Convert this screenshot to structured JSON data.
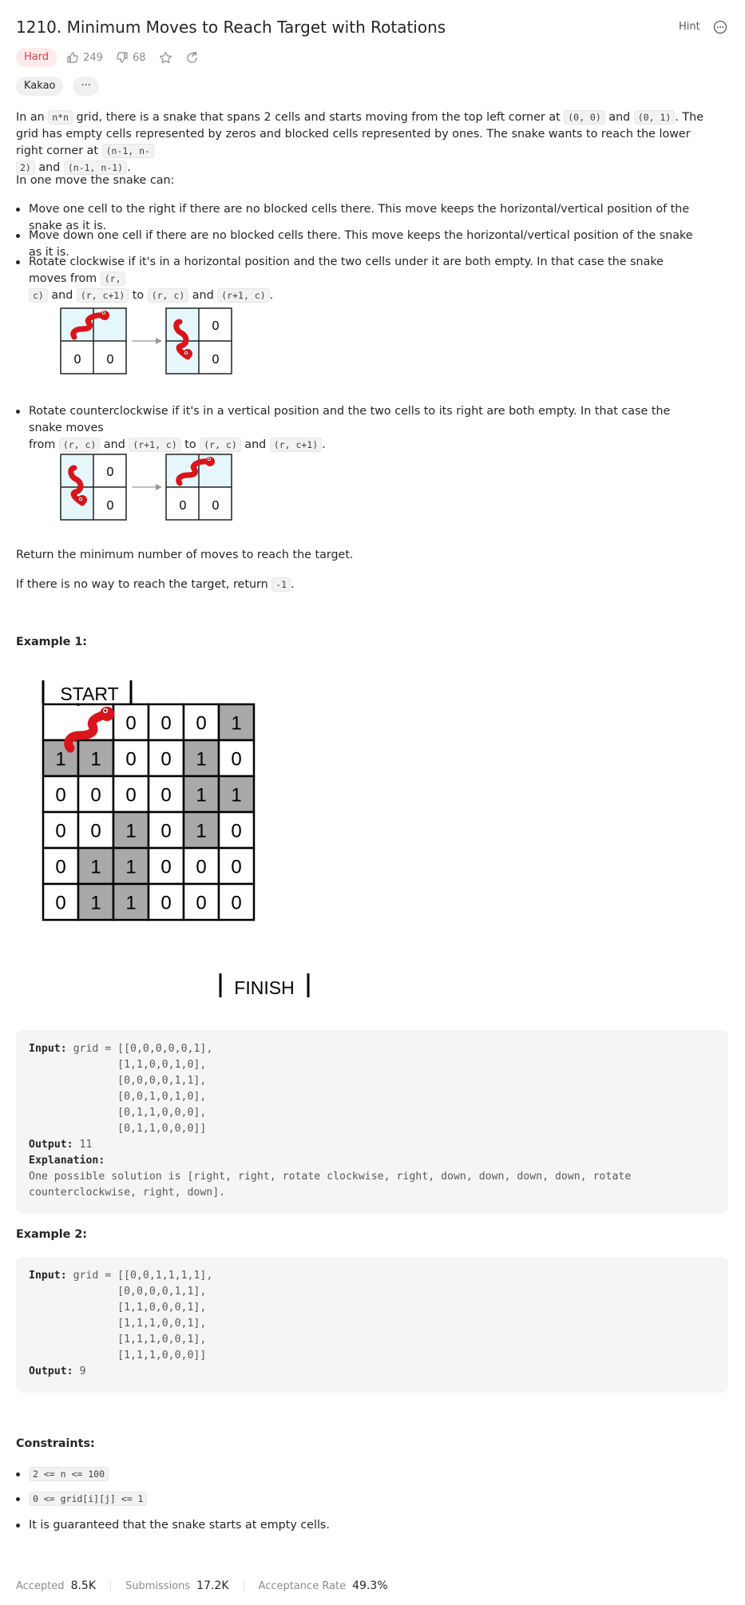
{
  "header": {
    "title": "1210. Minimum Moves to Reach Target with Rotations",
    "hint_label": "Hint",
    "more_icon": "more-horizontal-icon"
  },
  "meta": {
    "difficulty": "Hard",
    "likes": "249",
    "dislikes": "68",
    "company_tag": "Kakao",
    "more_tags_label": "···"
  },
  "description": {
    "p1_a": "In an ",
    "p1_code_nxn": "n*n",
    "p1_b": " grid, there is a snake that spans 2 cells and starts moving from the top left corner at ",
    "p1_code_00": "(0, 0)",
    "p1_c": " and ",
    "p1_code_01": "(0, 1)",
    "p1_d": ". The grid has empty cells represented by zeros and blocked cells represented by ones. The snake wants to reach the lower right corner at ",
    "p1_code_t1_line1": "(n-1, n-",
    "p1_code_t1_line2": "2)",
    "p1_e": " and ",
    "p1_code_t2": "(n-1, n-1)",
    "p1_f": ".",
    "p2": "In one move the snake can:",
    "b1": "Move one cell to the right if there are no blocked cells there. This move keeps the horizontal/vertical position of the snake as it is.",
    "b2": "Move down one cell if there are no blocked cells there. This move keeps the horizontal/vertical position of the snake as it is.",
    "b3_a": "Rotate clockwise if it's in a horizontal position and the two cells under it are both empty. In that case the snake moves from ",
    "b3_c1_line1": "(r,",
    "b3_c1_line2": "c)",
    "b3_b": " and ",
    "b3_c2": "(r, c+1)",
    "b3_to": " to ",
    "b3_c3": "(r, c)",
    "b3_and": " and ",
    "b3_c4": "(r+1, c)",
    "b3_end": ".",
    "b4_a": "Rotate counterclockwise if it's in a vertical position and the two cells to its right are both empty. In that case the snake moves",
    "b4_from": "from ",
    "b4_c1": "(r, c)",
    "b4_and1": " and ",
    "b4_c2": "(r+1, c)",
    "b4_to": " to ",
    "b4_c3": "(r, c)",
    "b4_and2": " and ",
    "b4_c4": "(r, c+1)",
    "b4_end": ".",
    "p3": "Return the minimum number of moves to reach the target.",
    "p4_a": "If there is no way to reach the target, return ",
    "p4_code": "-1",
    "p4_b": "."
  },
  "rotation_figures": {
    "zero": "0"
  },
  "example1": {
    "heading": "Example 1:",
    "start_label": "START",
    "finish_label": "FINISH",
    "grid": [
      [
        0,
        0,
        0,
        0,
        0,
        1
      ],
      [
        1,
        1,
        0,
        0,
        1,
        0
      ],
      [
        0,
        0,
        0,
        0,
        1,
        1
      ],
      [
        0,
        0,
        1,
        0,
        1,
        0
      ],
      [
        0,
        1,
        1,
        0,
        0,
        0
      ],
      [
        0,
        1,
        1,
        0,
        0,
        0
      ]
    ],
    "input_label": "Input:",
    "input_lines": [
      "grid = [[0,0,0,0,0,1],",
      "        [1,1,0,0,1,0],",
      "        [0,0,0,0,1,1],",
      "        [0,0,1,0,1,0],",
      "        [0,1,1,0,0,0],",
      "        [0,1,1,0,0,0]]"
    ],
    "output_label": "Output:",
    "output_value": "11",
    "explanation_label": "Explanation:",
    "explanation_line1": "One possible solution is [right, right, rotate clockwise, right, down, down, down, down, rotate",
    "explanation_line2": "counterclockwise, right, down]."
  },
  "example2": {
    "heading": "Example 2:",
    "input_label": "Input:",
    "input_lines": [
      "grid = [[0,0,1,1,1,1],",
      "        [0,0,0,0,1,1],",
      "        [1,1,0,0,0,1],",
      "        [1,1,1,0,0,1],",
      "        [1,1,1,0,0,1],",
      "        [1,1,1,0,0,0]]"
    ],
    "output_label": "Output:",
    "output_value": "9"
  },
  "constraints": {
    "heading": "Constraints:",
    "c1": "2 <= n <= 100",
    "c2": "0 <= grid[i][j] <= 1",
    "c3": "It is guaranteed that the snake starts at empty cells."
  },
  "stats": {
    "accepted_label": "Accepted",
    "accepted_value": "8.5K",
    "submissions_label": "Submissions",
    "submissions_value": "17.2K",
    "rate_label": "Acceptance Rate",
    "rate_value": "49.3%"
  },
  "colors": {
    "hard_text": "#e0424e",
    "hard_bg": "#fdeaea",
    "blocked_cell": "#a9a9a9",
    "snake_cell": "#e6f7fc",
    "snake_red": "#d9141b"
  }
}
